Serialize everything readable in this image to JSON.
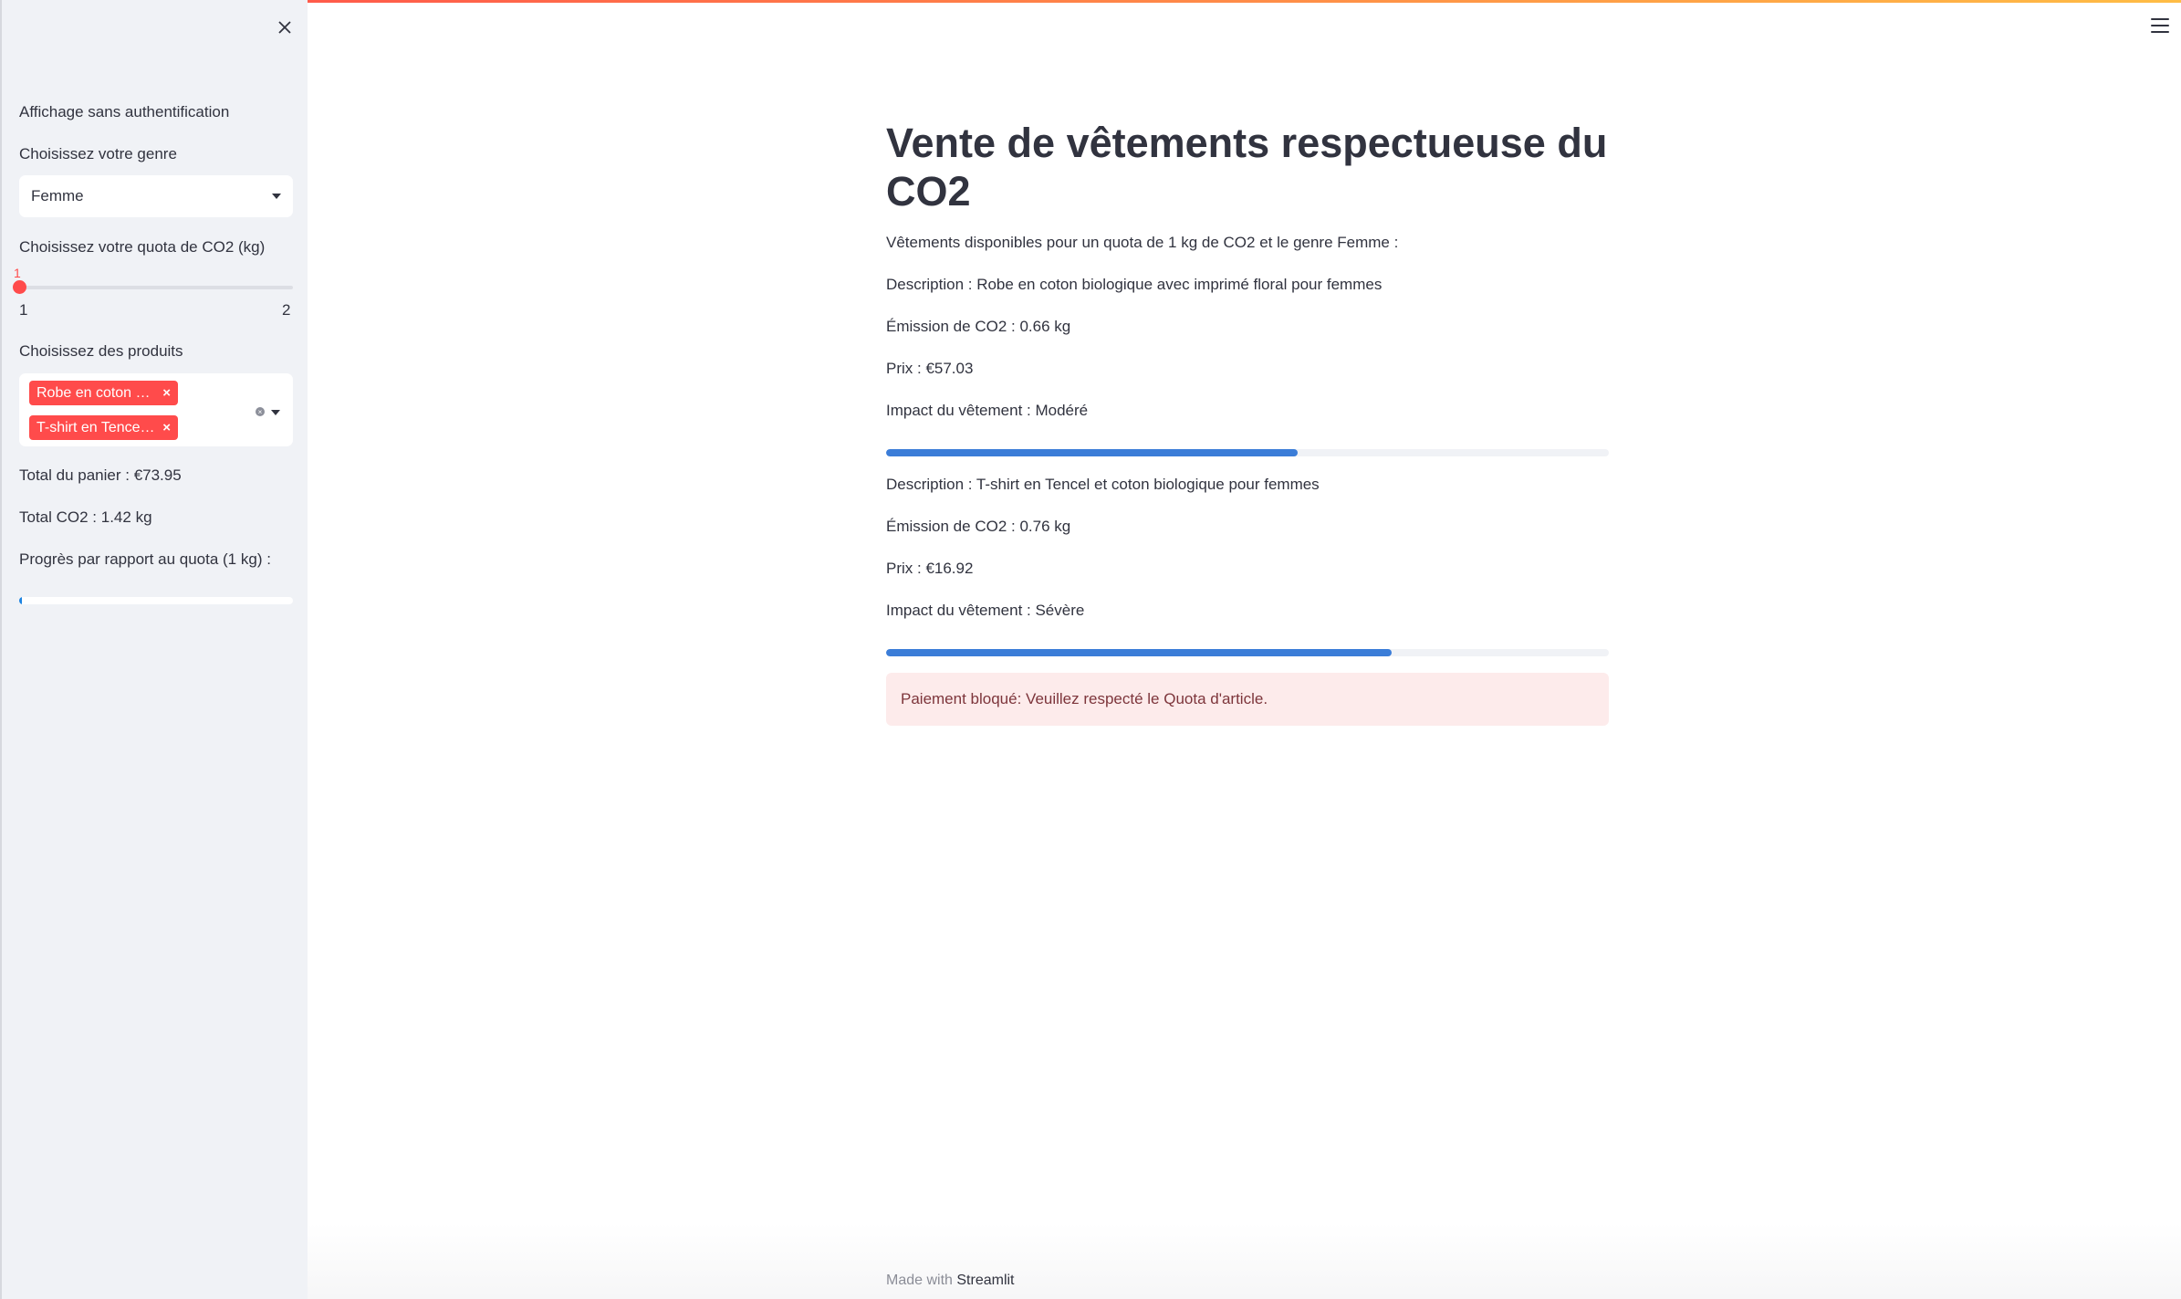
{
  "sidebar": {
    "auth_text": "Affichage sans authentification",
    "gender_label": "Choisissez votre genre",
    "gender_value": "Femme",
    "quota_label": "Choisissez votre quota de CO2 (kg)",
    "quota_value": "1",
    "quota_min": "1",
    "quota_max": "2",
    "quota_fraction": 0,
    "products_label": "Choisissez des produits",
    "selected_products": [
      "Robe en coton biologique avec imprimé floral pour femmes",
      "T-shirt en Tencel et coton biologique pour femmes"
    ],
    "total_cart": "Total du panier : €73.95",
    "total_co2": "Total CO2 : 1.42 kg",
    "progress_label": "Progrès par rapport au quota (1 kg) :",
    "progress_fraction": 0.01
  },
  "main": {
    "title": "Vente de vêtements respectueuse du CO2",
    "intro": "Vêtements disponibles pour un quota de 1 kg de CO2 et le genre Femme :",
    "products": [
      {
        "description": "Description : Robe en coton biologique avec imprimé floral pour femmes",
        "emission": "Émission de CO2 : 0.66 kg",
        "price": "Prix : €57.03",
        "impact": "Impact du vêtement : Modéré",
        "impact_fraction": 0.57
      },
      {
        "description": "Description : T-shirt en Tencel et coton biologique pour femmes",
        "emission": "Émission de CO2 : 0.76 kg",
        "price": "Prix : €16.92",
        "impact": "Impact du vêtement : Sévère",
        "impact_fraction": 0.7
      }
    ],
    "alert": "Paiement bloqué: Veuillez respecté le Quota d'article."
  },
  "footer": {
    "prefix": "Made with",
    "brand": "Streamlit"
  },
  "colors": {
    "accent": "#ff4b4b",
    "progress": "#3b7dd8",
    "sidebar_bg": "#f0f2f6",
    "alert_bg": "#fdebeb"
  }
}
